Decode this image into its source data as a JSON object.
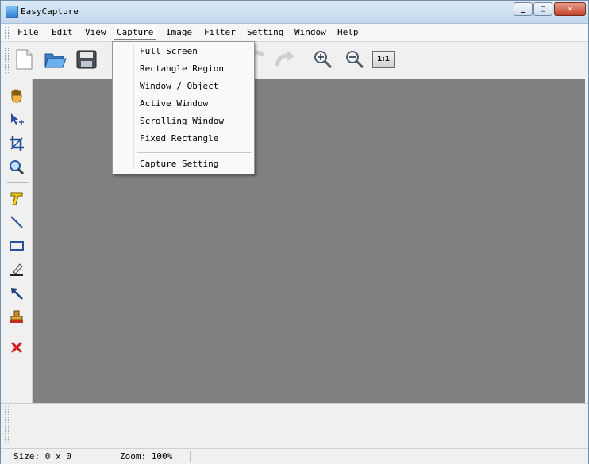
{
  "window": {
    "title": "EasyCapture"
  },
  "menu": [
    {
      "label": "File"
    },
    {
      "label": "Edit"
    },
    {
      "label": "View"
    },
    {
      "label": "Capture"
    },
    {
      "label": "Image"
    },
    {
      "label": "Filter"
    },
    {
      "label": "Setting"
    },
    {
      "label": "Window"
    },
    {
      "label": "Help"
    }
  ],
  "capture_menu": {
    "items": [
      {
        "label": "Full Screen"
      },
      {
        "label": "Rectangle Region"
      },
      {
        "label": "Window / Object"
      },
      {
        "label": "Active Window"
      },
      {
        "label": "Scrolling Window"
      },
      {
        "label": "Fixed Rectangle"
      },
      {
        "label": "Capture Setting"
      }
    ]
  },
  "toolbar": {
    "icons": [
      "new-file-icon",
      "open-folder-icon",
      "save-icon",
      "undo-icon",
      "redo-icon",
      "zoom-in-icon",
      "zoom-out-icon",
      "actual-size-icon"
    ],
    "actual_size_label": "1:1"
  },
  "left_tools": {
    "icons": [
      "hand-icon",
      "select-move-icon",
      "crop-icon",
      "magnify-icon",
      "text-icon",
      "line-icon",
      "rectangle-icon",
      "highlighter-icon",
      "arrow-icon",
      "stamp-icon",
      "delete-icon"
    ]
  },
  "status": {
    "size": "Size: 0 x 0",
    "zoom": "Zoom: 100%"
  },
  "colors": {
    "canvas": "#808080",
    "accent": "#1f5fa8",
    "delete": "#d22020"
  }
}
